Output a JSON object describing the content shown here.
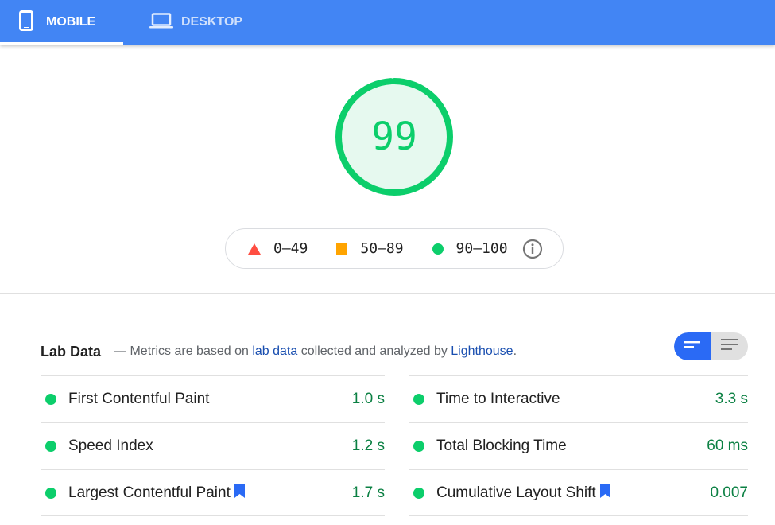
{
  "tabs": {
    "mobile": {
      "label": "Mobile",
      "icon": "smartphone-icon"
    },
    "desktop": {
      "label": "Desktop",
      "icon": "laptop-icon"
    }
  },
  "score": {
    "value": "99",
    "fraction": 0.99,
    "color": "#0cce6b"
  },
  "legend": {
    "fail": {
      "range": "0–49",
      "icon": "triangle-icon",
      "color": "#ff4e42"
    },
    "average": {
      "range": "50–89",
      "icon": "square-icon",
      "color": "#ffa400"
    },
    "pass": {
      "range": "90–100",
      "icon": "circle-icon",
      "color": "#0cce6b"
    },
    "info_icon": "info-icon"
  },
  "lab": {
    "title": "Lab Data",
    "desc_prefix": "— Metrics are based on ",
    "desc_link1": "lab data",
    "desc_middle": " collected and analyzed by ",
    "desc_link2": "Lighthouse",
    "desc_suffix": "."
  },
  "view_toggle": {
    "left_icon": "short-lines-icon",
    "right_icon": "full-lines-icon"
  },
  "metrics": {
    "left": [
      {
        "name": "First Contentful Paint",
        "value": "1.0 s"
      },
      {
        "name": "Speed Index",
        "value": "1.2 s"
      },
      {
        "name": "Largest Contentful Paint",
        "value": "1.7 s",
        "flag": "bookmark-icon"
      }
    ],
    "right": [
      {
        "name": "Time to Interactive",
        "value": "3.3 s"
      },
      {
        "name": "Total Blocking Time",
        "value": "60 ms"
      },
      {
        "name": "Cumulative Layout Shift",
        "value": "0.007",
        "flag": "bookmark-icon"
      }
    ]
  }
}
